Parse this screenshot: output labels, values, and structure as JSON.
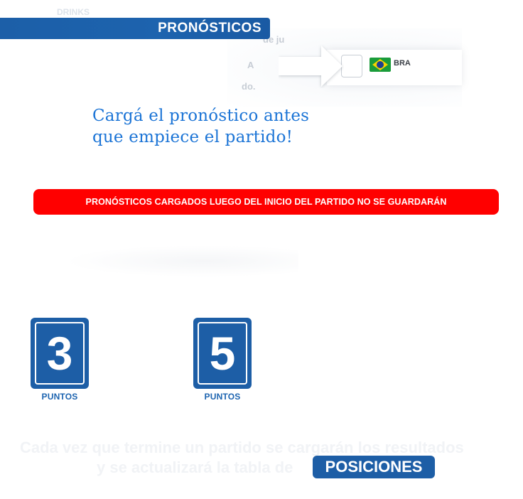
{
  "header": {
    "title": "PRONÓSTICOS",
    "ghost_text": "DRINKS"
  },
  "preview": {
    "ghost_lines": [
      "de ju",
      "A",
      "do."
    ],
    "team_code": "BRA"
  },
  "headline": {
    "line1": "Cargá el pronóstico antes",
    "line2": "que empiece el partido!"
  },
  "warning": {
    "text": "PRONÓSTICOS CARGADOS LUEGO DEL INICIO DEL PARTIDO NO SE GUARDARÁN"
  },
  "points": [
    {
      "value": "3",
      "label": "PUNTOS"
    },
    {
      "value": "5",
      "label": "PUNTOS"
    }
  ],
  "footer": {
    "line1": "Cada vez que termine un partido se cargarán los resultados",
    "line2": "y se actualizará la tabla de",
    "badge": "POSICIONES"
  },
  "colors": {
    "primary_blue": "#1d5ea6",
    "headline_blue": "#1b74d6",
    "warning_red": "#ff0000"
  }
}
